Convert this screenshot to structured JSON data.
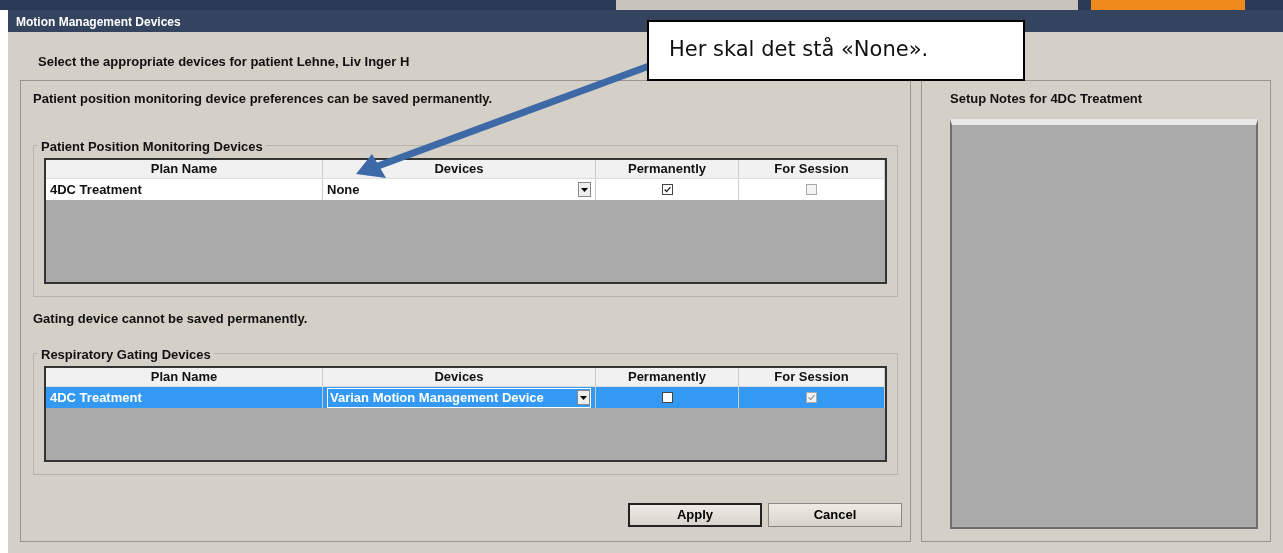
{
  "window": {
    "title": "Motion Management Devices"
  },
  "instruction": "Select the appropriate devices for patient Lehne, Liv Inger H",
  "sections": [
    {
      "note": "Patient position monitoring device preferences can be saved permanently.",
      "group": {
        "title": "Patient Position Monitoring Devices",
        "columns": [
          "Plan Name",
          "Devices",
          "Permanently",
          "For Session"
        ],
        "rows": [
          {
            "plan_name": "4DC Treatment",
            "device": "None",
            "selected": false,
            "permanently": {
              "checked": true,
              "disabled": false
            },
            "for_session": {
              "checked": false,
              "disabled": true
            }
          }
        ]
      }
    },
    {
      "note": "Gating device cannot be saved permanently.",
      "group": {
        "title": "Respiratory Gating Devices",
        "columns": [
          "Plan Name",
          "Devices",
          "Permanently",
          "For Session"
        ],
        "rows": [
          {
            "plan_name": "4DC Treatment",
            "device": "Varian Motion Management Device",
            "selected": true,
            "permanently": {
              "checked": false,
              "disabled": false
            },
            "for_session": {
              "checked": true,
              "disabled": true
            }
          }
        ]
      }
    }
  ],
  "buttons": [
    {
      "label": "Apply",
      "default": true
    },
    {
      "label": "Cancel",
      "default": false
    }
  ],
  "setup_notes": {
    "title": "Setup Notes for 4DC Treatment"
  },
  "callout": {
    "text": "Her skal det stå «None»."
  }
}
